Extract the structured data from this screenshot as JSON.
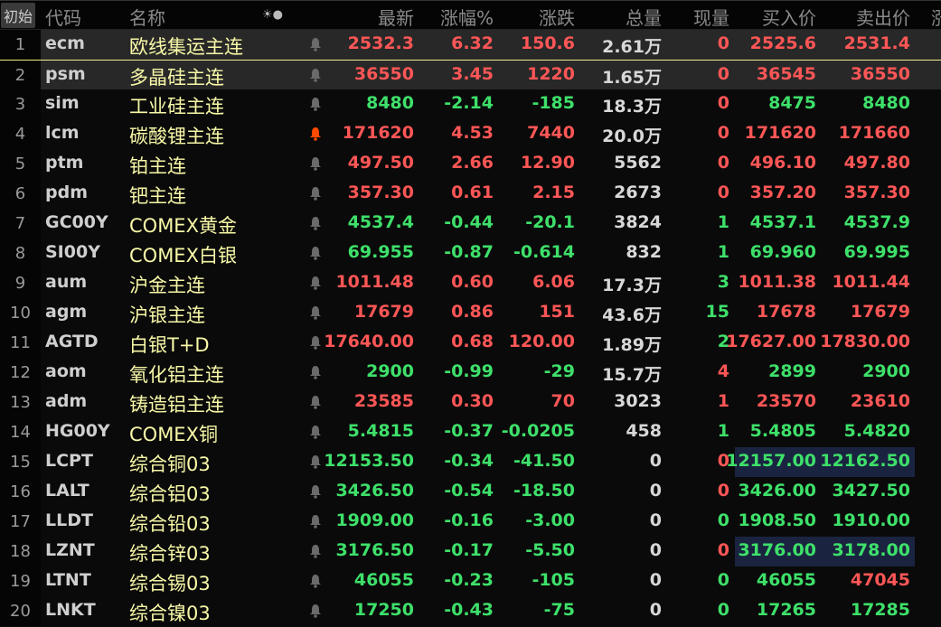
{
  "header": {
    "init": "初始",
    "code": "代码",
    "name": "名称",
    "icons": "☀●",
    "last": "最新",
    "pct": "涨幅%",
    "chg": "涨跌",
    "vol": "总量",
    "cur": "现量",
    "bid": "买入价",
    "ask": "卖出价",
    "more": "涨"
  },
  "colors": {
    "up": "#ff5656",
    "down": "#3ee06a",
    "name": "#f8f8a8",
    "alert": "#ff4a00",
    "bell": "#6a6a6a",
    "highlight": "#1a2440"
  },
  "rows": [
    {
      "num": "1",
      "code": "ecm",
      "name": "欧线集运主连",
      "last": "2532.3",
      "pct": "6.32",
      "chg": "150.6",
      "vol": "2.61万",
      "cur": "0",
      "bid": "2525.6",
      "ask": "2531.4",
      "dir": "up",
      "curDir": "up",
      "sel": true
    },
    {
      "num": "2",
      "code": "psm",
      "name": "多晶硅主连",
      "last": "36550",
      "pct": "3.45",
      "chg": "1220",
      "vol": "1.65万",
      "cur": "0",
      "bid": "36545",
      "ask": "36550",
      "dir": "up",
      "curDir": "up",
      "sel": true,
      "current": true
    },
    {
      "num": "3",
      "code": "sim",
      "name": "工业硅主连",
      "last": "8480",
      "pct": "-2.14",
      "chg": "-185",
      "vol": "18.3万",
      "cur": "0",
      "bid": "8475",
      "ask": "8480",
      "dir": "dn",
      "curDir": "up"
    },
    {
      "num": "4",
      "code": "lcm",
      "name": "碳酸锂主连",
      "last": "171620",
      "pct": "4.53",
      "chg": "7440",
      "vol": "20.0万",
      "cur": "0",
      "bid": "171620",
      "ask": "171660",
      "dir": "up",
      "curDir": "up",
      "alert": true
    },
    {
      "num": "5",
      "code": "ptm",
      "name": "铂主连",
      "last": "497.50",
      "pct": "2.66",
      "chg": "12.90",
      "vol": "5562",
      "cur": "0",
      "bid": "496.10",
      "ask": "497.80",
      "dir": "up",
      "curDir": "up"
    },
    {
      "num": "6",
      "code": "pdm",
      "name": "钯主连",
      "last": "357.30",
      "pct": "0.61",
      "chg": "2.15",
      "vol": "2673",
      "cur": "0",
      "bid": "357.20",
      "ask": "357.30",
      "dir": "up",
      "curDir": "up"
    },
    {
      "num": "7",
      "code": "GC00Y",
      "name": "COMEX黄金",
      "last": "4537.4",
      "pct": "-0.44",
      "chg": "-20.1",
      "vol": "3824",
      "cur": "1",
      "bid": "4537.1",
      "ask": "4537.9",
      "dir": "dn",
      "curDir": "dn"
    },
    {
      "num": "8",
      "code": "SI00Y",
      "name": "COMEX白银",
      "last": "69.955",
      "pct": "-0.87",
      "chg": "-0.614",
      "vol": "832",
      "cur": "1",
      "bid": "69.960",
      "ask": "69.995",
      "dir": "dn",
      "curDir": "dn"
    },
    {
      "num": "9",
      "code": "aum",
      "name": "沪金主连",
      "last": "1011.48",
      "pct": "0.60",
      "chg": "6.06",
      "vol": "17.3万",
      "cur": "3",
      "bid": "1011.38",
      "ask": "1011.44",
      "dir": "up",
      "curDir": "dn"
    },
    {
      "num": "10",
      "code": "agm",
      "name": "沪银主连",
      "last": "17679",
      "pct": "0.86",
      "chg": "151",
      "vol": "43.6万",
      "cur": "15",
      "bid": "17678",
      "ask": "17679",
      "dir": "up",
      "curDir": "dn"
    },
    {
      "num": "11",
      "code": "AGTD",
      "name": "白银T+D",
      "last": "17640.00",
      "pct": "0.68",
      "chg": "120.00",
      "vol": "1.89万",
      "cur": "2",
      "bid": "17627.00",
      "ask": "17830.00",
      "dir": "up",
      "curDir": "dn"
    },
    {
      "num": "12",
      "code": "aom",
      "name": "氧化铝主连",
      "last": "2900",
      "pct": "-0.99",
      "chg": "-29",
      "vol": "15.7万",
      "cur": "4",
      "bid": "2899",
      "ask": "2900",
      "dir": "dn",
      "curDir": "up"
    },
    {
      "num": "13",
      "code": "adm",
      "name": "铸造铝主连",
      "last": "23585",
      "pct": "0.30",
      "chg": "70",
      "vol": "3023",
      "cur": "1",
      "bid": "23570",
      "ask": "23610",
      "dir": "up",
      "curDir": "up"
    },
    {
      "num": "14",
      "code": "HG00Y",
      "name": "COMEX铜",
      "last": "5.4815",
      "pct": "-0.37",
      "chg": "-0.0205",
      "vol": "458",
      "cur": "1",
      "bid": "5.4805",
      "ask": "5.4820",
      "dir": "dn",
      "curDir": "dn"
    },
    {
      "num": "15",
      "code": "LCPT",
      "name": "综合铜03",
      "last": "12153.50",
      "pct": "-0.34",
      "chg": "-41.50",
      "vol": "0",
      "cur": "0",
      "bid": "12157.00",
      "ask": "12162.50",
      "dir": "dn",
      "curDir": "up",
      "hl": true
    },
    {
      "num": "16",
      "code": "LALT",
      "name": "综合铝03",
      "last": "3426.50",
      "pct": "-0.54",
      "chg": "-18.50",
      "vol": "0",
      "cur": "0",
      "bid": "3426.00",
      "ask": "3427.50",
      "dir": "dn",
      "curDir": "up"
    },
    {
      "num": "17",
      "code": "LLDT",
      "name": "综合铅03",
      "last": "1909.00",
      "pct": "-0.16",
      "chg": "-3.00",
      "vol": "0",
      "cur": "0",
      "bid": "1908.50",
      "ask": "1910.00",
      "dir": "dn",
      "curDir": "dn"
    },
    {
      "num": "18",
      "code": "LZNT",
      "name": "综合锌03",
      "last": "3176.50",
      "pct": "-0.17",
      "chg": "-5.50",
      "vol": "0",
      "cur": "0",
      "bid": "3176.00",
      "ask": "3178.00",
      "dir": "dn",
      "curDir": "up",
      "hl": true
    },
    {
      "num": "19",
      "code": "LTNT",
      "name": "综合锡03",
      "last": "46055",
      "pct": "-0.23",
      "chg": "-105",
      "vol": "0",
      "cur": "0",
      "bid": "46055",
      "ask": "47045",
      "dir": "dn",
      "curDir": "dn",
      "askDir": "up"
    },
    {
      "num": "20",
      "code": "LNKT",
      "name": "综合镍03",
      "last": "17250",
      "pct": "-0.43",
      "chg": "-75",
      "vol": "0",
      "cur": "0",
      "bid": "17265",
      "ask": "17285",
      "dir": "dn",
      "curDir": "dn"
    }
  ]
}
